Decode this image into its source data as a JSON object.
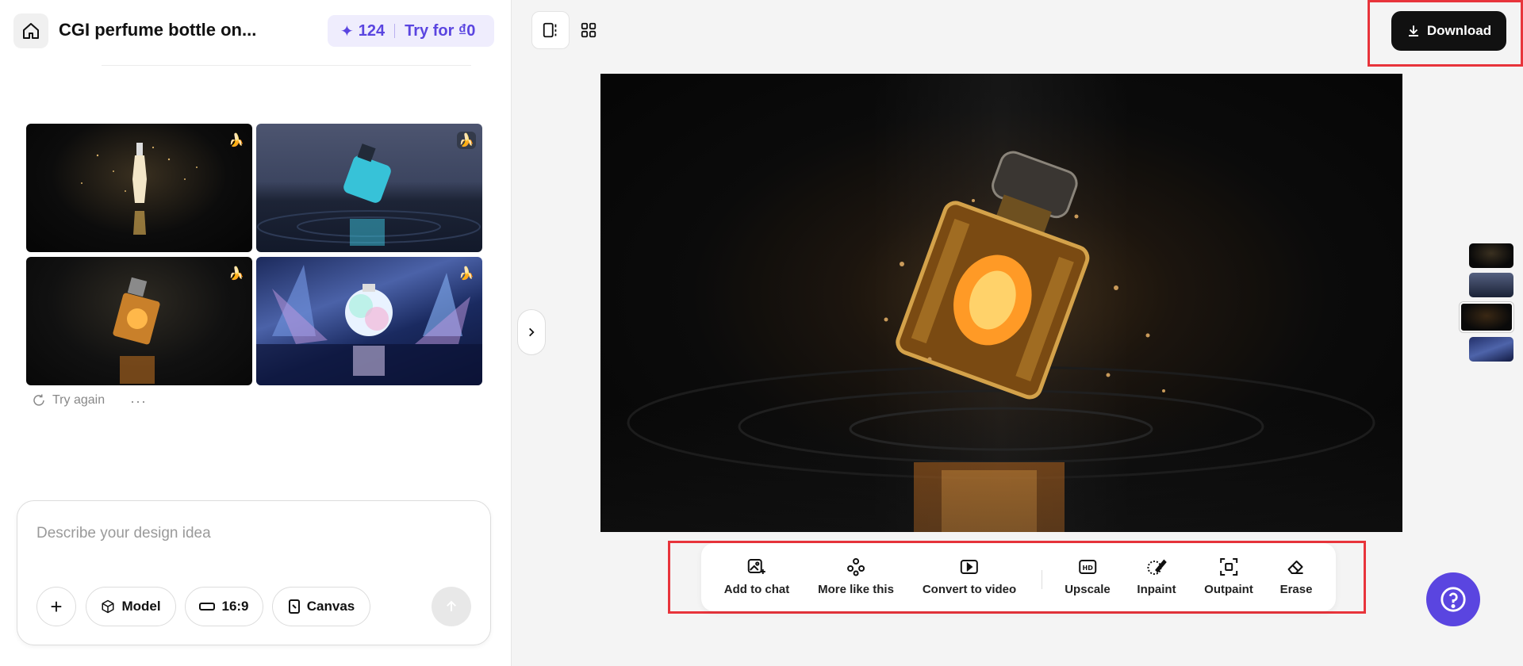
{
  "project": {
    "title": "CGI perfume bottle on..."
  },
  "credits": {
    "count": "124",
    "try_label": "Try for ₫0"
  },
  "history": {
    "try_again_label": "Try again",
    "more_label": "···"
  },
  "composer": {
    "placeholder": "Describe your design idea",
    "model_label": "Model",
    "ratio_label": "16:9",
    "canvas_label": "Canvas"
  },
  "toolbar": {
    "download_label": "Download"
  },
  "tools": [
    {
      "label": "Add to chat",
      "icon": "image-add-icon"
    },
    {
      "label": "More like this",
      "icon": "variations-icon"
    },
    {
      "label": "Convert to video",
      "icon": "video-play-icon"
    },
    {
      "label": "Upscale",
      "icon": "hd-icon"
    },
    {
      "label": "Inpaint",
      "icon": "brush-icon"
    },
    {
      "label": "Outpaint",
      "icon": "expand-frame-icon"
    },
    {
      "label": "Erase",
      "icon": "eraser-icon"
    }
  ],
  "colors": {
    "accent": "#5a45e0",
    "highlight": "#e8343b",
    "dark": "#111111"
  }
}
